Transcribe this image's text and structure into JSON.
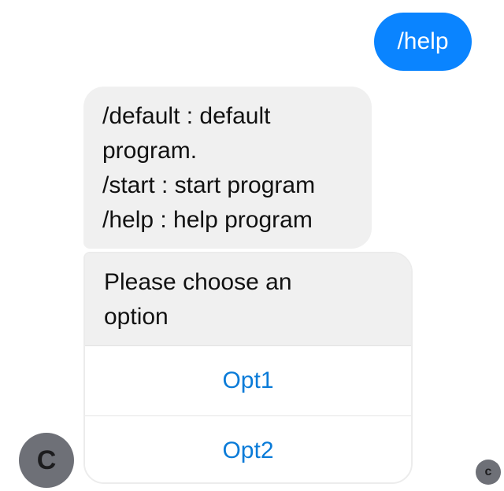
{
  "messages": {
    "outgoing": {
      "text": "/help"
    },
    "incoming_help": {
      "lines": [
        "/default : default",
        "program.",
        "/start : start program",
        "/help : help program"
      ]
    },
    "options_card": {
      "prompt_lines": [
        "Please choose an",
        "option"
      ],
      "options": [
        "Opt1",
        "Opt2"
      ]
    }
  },
  "avatars": {
    "bot_initial": "C",
    "read_receipt_initial": "c"
  },
  "colors": {
    "outgoing_bubble": "#0a84ff",
    "incoming_bubble": "#f0f0f0",
    "option_text": "#0a7bd8",
    "avatar_bg": "#6e7077"
  }
}
